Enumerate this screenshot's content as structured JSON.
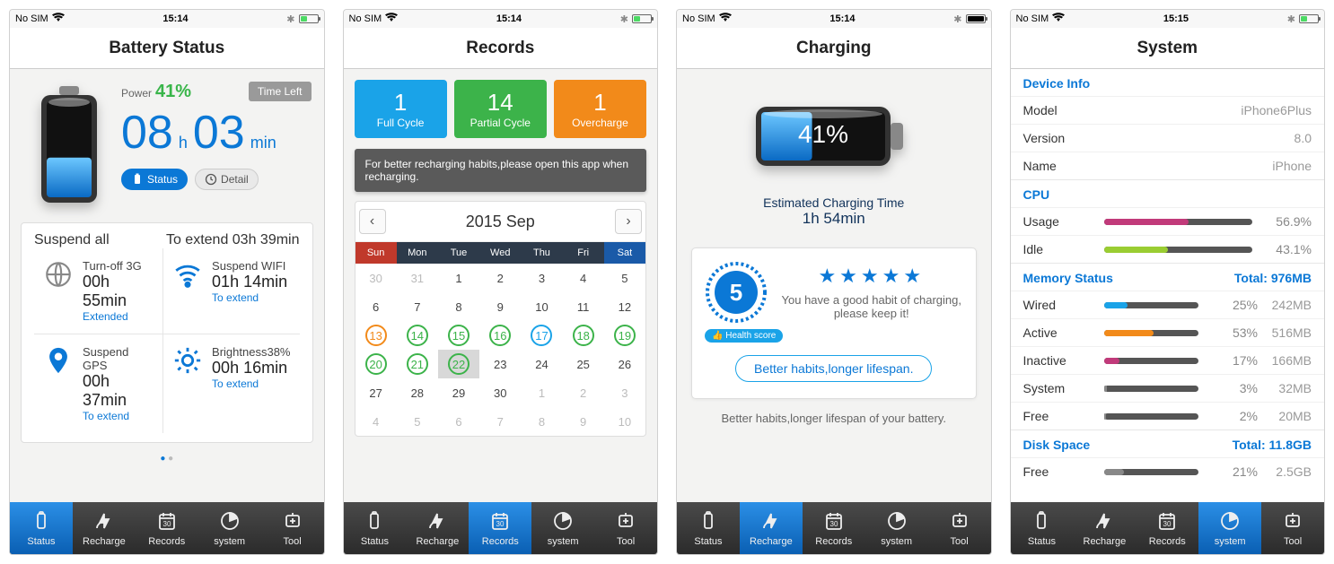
{
  "screens": [
    {
      "statusbar": {
        "carrier": "No SIM",
        "time": "15:14",
        "battery_pct": 41
      },
      "title": "Battery Status",
      "power_label": "Power",
      "power_pct": "41%",
      "time_left_label": "Time Left",
      "hours": "08",
      "hours_unit": "h",
      "mins": "03",
      "mins_unit": "min",
      "modes": {
        "status": "Status",
        "detail": "Detail"
      },
      "suspend_all": "Suspend all",
      "to_extend": "To extend 03h 39min",
      "quads": [
        {
          "icon": "globe",
          "label": "Turn-off 3G",
          "time": "00h 55min",
          "link": "Extended"
        },
        {
          "icon": "wifi",
          "label": "Suspend WIFI",
          "time": "01h 14min",
          "link": "To extend"
        },
        {
          "icon": "gps",
          "label": "Suspend GPS",
          "time": "00h 37min",
          "link": "To extend"
        },
        {
          "icon": "sun",
          "label": "Brightness38%",
          "time": "00h 16min",
          "link": "To extend"
        }
      ]
    },
    {
      "statusbar": {
        "carrier": "No SIM",
        "time": "15:14",
        "battery_pct": 41
      },
      "title": "Records",
      "stats": [
        {
          "n": "1",
          "t": "Full Cycle",
          "c": "blue"
        },
        {
          "n": "14",
          "t": "Partial Cycle",
          "c": "green"
        },
        {
          "n": "1",
          "t": "Overcharge",
          "c": "orange"
        }
      ],
      "tip": "For better recharging habits,please open this app when recharging.",
      "cal_title": "2015 Sep",
      "day_headers": [
        "Sun",
        "Mon",
        "Tue",
        "Wed",
        "Thu",
        "Fri",
        "Sat"
      ],
      "selected_day": 22,
      "rings": {
        "13": "orange",
        "14": "green",
        "15": "green",
        "16": "green",
        "17": "blue",
        "18": "green",
        "19": "green",
        "20": "green",
        "21": "green",
        "22": "green"
      },
      "lead_dim": [
        30,
        31
      ],
      "days_in_month": 30,
      "trail_dim": [
        1,
        2,
        3,
        4,
        5,
        6,
        7,
        8,
        9,
        10
      ]
    },
    {
      "statusbar": {
        "carrier": "No SIM",
        "time": "15:14",
        "battery_pct": 100,
        "full": true
      },
      "title": "Charging",
      "pct": "41%",
      "est_label": "Estimated Charging Time",
      "est_value": "1h 54min",
      "score": 5,
      "good_msg": "You have a good habit of charging, please keep it!",
      "health_label": "Health score",
      "better_habits": "Better habits,longer lifespan.",
      "footer": "Better habits,longer lifespan of your battery."
    },
    {
      "statusbar": {
        "carrier": "No SIM",
        "time": "15:15",
        "battery_pct": 41
      },
      "title": "System",
      "sections": {
        "device": {
          "title": "Device Info",
          "rows": [
            {
              "k": "Model",
              "v": "iPhone6Plus"
            },
            {
              "k": "Version",
              "v": "8.0"
            },
            {
              "k": "Name",
              "v": "iPhone"
            }
          ]
        },
        "cpu": {
          "title": "CPU",
          "rows": [
            {
              "k": "Usage",
              "pct": "56.9%",
              "w": 56.9,
              "color": "#c13a7a"
            },
            {
              "k": "Idle",
              "pct": "43.1%",
              "w": 43.1,
              "color": "#9acd32"
            }
          ]
        },
        "memory": {
          "title": "Memory Status",
          "extra": "Total: 976MB",
          "rows": [
            {
              "k": "Wired",
              "pct": "25%",
              "val": "242MB",
              "w": 25,
              "color": "#1aa3e8"
            },
            {
              "k": "Active",
              "pct": "53%",
              "val": "516MB",
              "w": 53,
              "color": "#f28a1a"
            },
            {
              "k": "Inactive",
              "pct": "17%",
              "val": "166MB",
              "w": 17,
              "color": "#c13a7a"
            },
            {
              "k": "System",
              "pct": "3%",
              "val": "32MB",
              "w": 3,
              "color": "#888"
            },
            {
              "k": "Free",
              "pct": "2%",
              "val": "20MB",
              "w": 2,
              "color": "#888"
            }
          ]
        },
        "disk": {
          "title": "Disk Space",
          "extra": "Total: 11.8GB",
          "rows": [
            {
              "k": "Free",
              "pct": "21%",
              "val": "2.5GB",
              "w": 21,
              "color": "#888"
            }
          ]
        }
      }
    }
  ],
  "tabs": [
    {
      "id": "status",
      "label": "Status"
    },
    {
      "id": "recharge",
      "label": "Recharge"
    },
    {
      "id": "records",
      "label": "Records"
    },
    {
      "id": "system",
      "label": "system"
    },
    {
      "id": "tool",
      "label": "Tool"
    }
  ],
  "active_tab_per_screen": [
    "status",
    "records",
    "recharge",
    "system"
  ]
}
